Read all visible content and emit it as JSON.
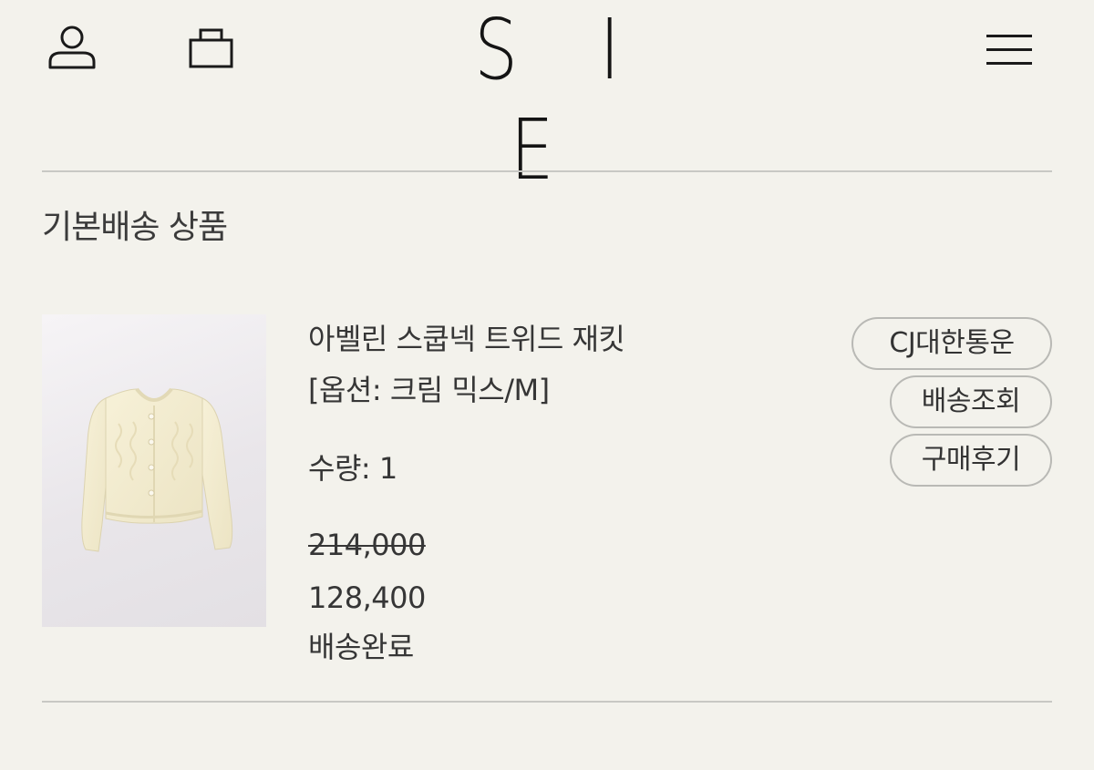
{
  "header": {
    "logo": "S I E",
    "user_icon": "user-icon",
    "bag_icon": "shopping-bag-icon",
    "menu_icon": "hamburger-menu-icon"
  },
  "section": {
    "title": "기본배송 상품"
  },
  "product": {
    "name": "아벨린 스쿱넥 트위드 재킷",
    "option": "[옵션: 크림 믹스/M]",
    "quantity": "수량: 1",
    "original_price": "214,000",
    "sale_price": "128,400",
    "status": "배송완료",
    "image": "cream-tweed-cardigan-photo"
  },
  "actions": {
    "carrier_label": "CJ대한통운",
    "track_label": "배송조회",
    "review_label": "구매후기"
  },
  "colors": {
    "background": "#f3f2ec",
    "text": "#363636",
    "divider": "#c8c8c4",
    "pill_border": "#b9b9b5"
  }
}
